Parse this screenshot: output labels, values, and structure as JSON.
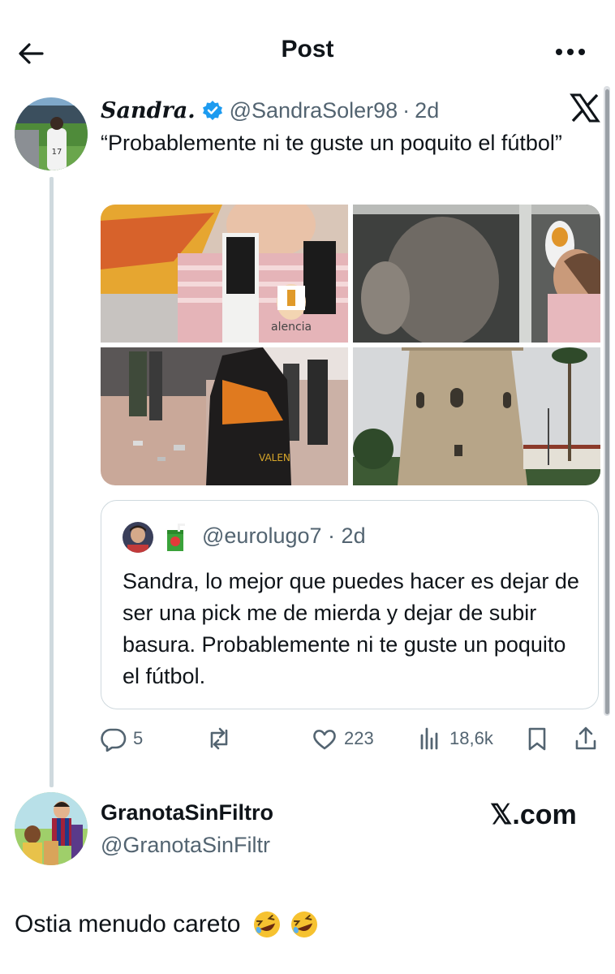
{
  "header": {
    "title": "Post"
  },
  "tweet": {
    "display_name": "Sandra.",
    "handle": "@SandraSoler98",
    "separator": "·",
    "time": "2d",
    "text": "“Probablemente ni te guste un poquito el fútbol”",
    "images": [
      "photo-child-valencia-scarf",
      "photo-child-with-father",
      "photo-fan-valencia-flag",
      "photo-torre-del-oro"
    ]
  },
  "quote": {
    "handle": "@eurolugo7",
    "separator": "·",
    "time": "2d",
    "text": "Sandra, lo mejor que puedes hacer es dejar de ser una pick me de mierda y dejar de subir basura. Probablemente ni te guste un poquito el fútbol."
  },
  "actions": {
    "replies": "5",
    "reposts": "",
    "likes": "223",
    "views": "18,6k"
  },
  "reply_post": {
    "display_name": "GranotaSinFiltro",
    "handle": "@GranotaSinFiltr",
    "watermark": "𝕏.com",
    "text": "Ostia menudo careto"
  },
  "colors": {
    "text": "#0f1419",
    "secondary": "#536471",
    "verified": "#1d9bf0",
    "border": "#cfd9de"
  },
  "icons": [
    "back-arrow-icon",
    "more-icon",
    "verified-badge-icon",
    "x-logo-icon",
    "reply-icon",
    "repost-icon",
    "like-icon",
    "views-icon",
    "bookmark-icon",
    "share-icon",
    "rofl-emoji-icon",
    "juice-box-emoji-icon"
  ]
}
